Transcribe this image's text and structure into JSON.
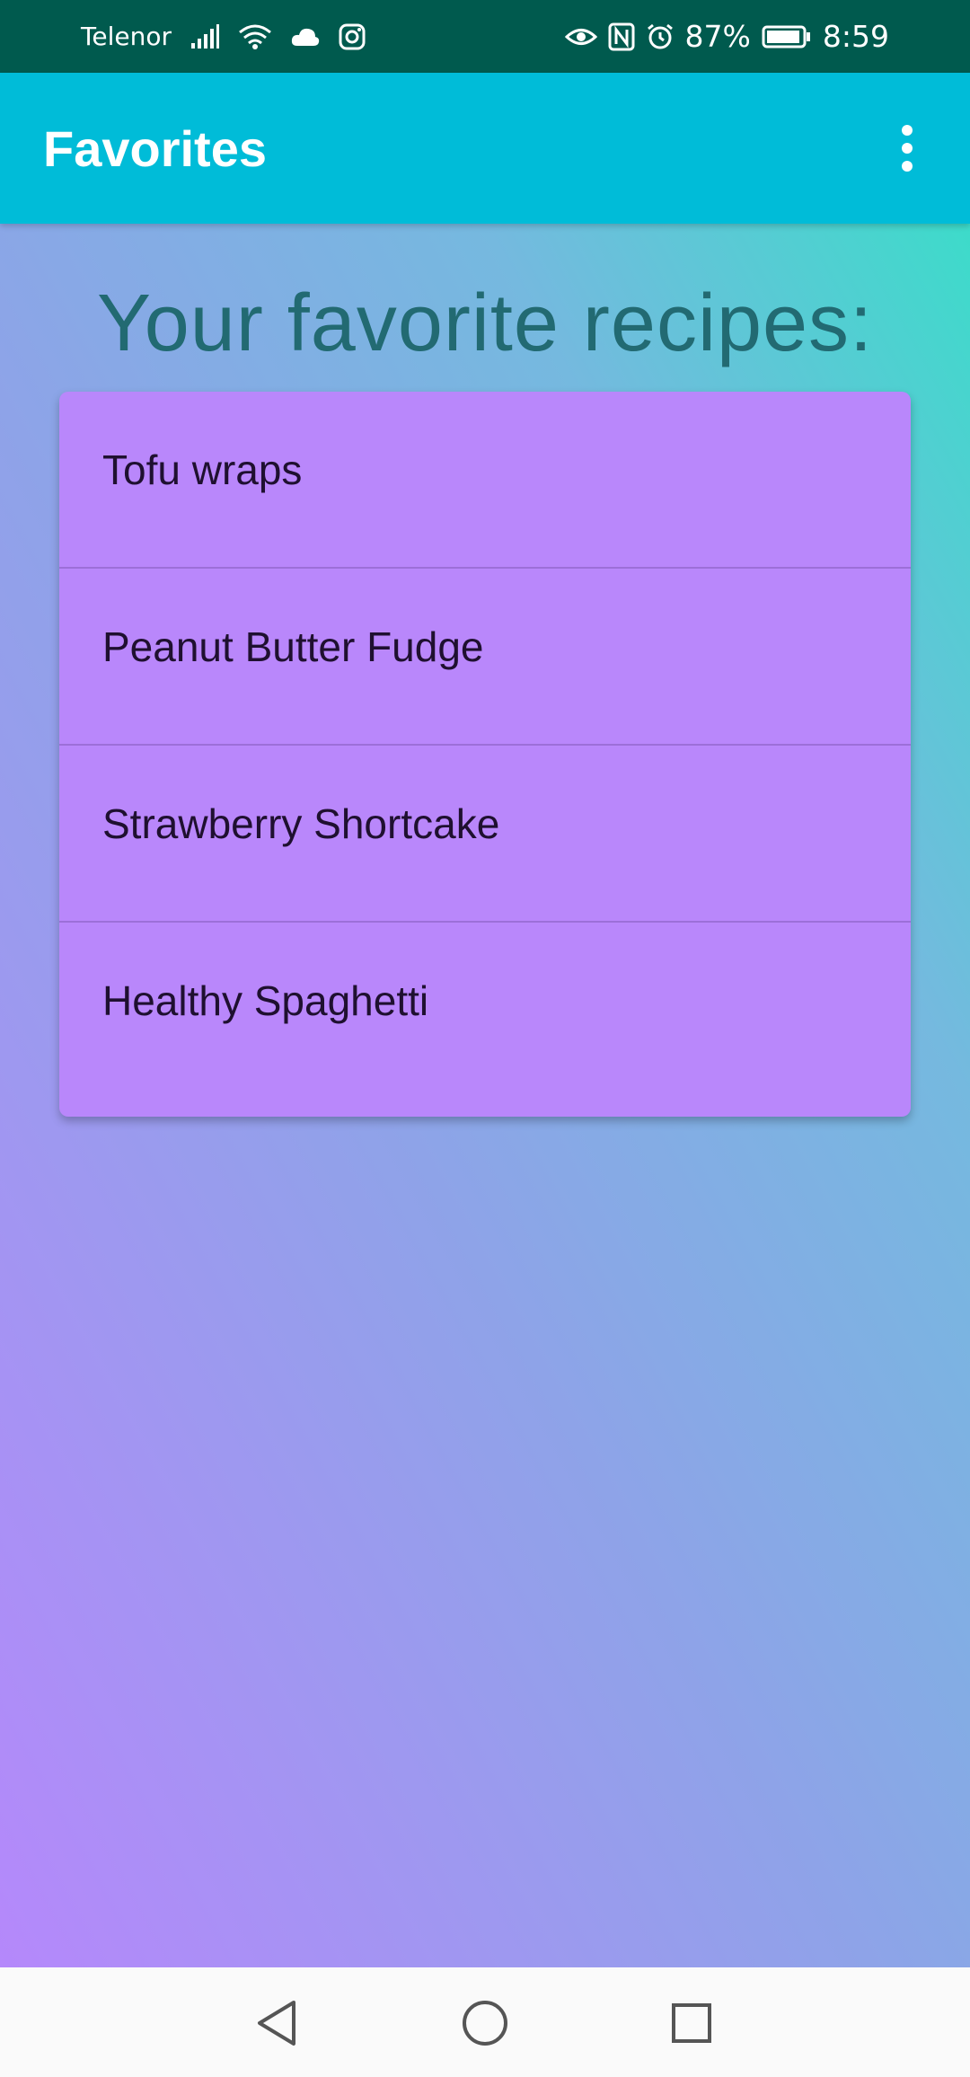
{
  "status_bar": {
    "carrier": "Telenor",
    "battery_percent": "87%",
    "time": "8:59",
    "icons_left": [
      "signal-icon",
      "wifi-icon",
      "cloud-icon",
      "instagram-icon"
    ],
    "icons_right": [
      "eye-icon",
      "nfc-icon",
      "alarm-icon",
      "battery-icon"
    ]
  },
  "app_bar": {
    "title": "Favorites",
    "menu_icon": "overflow-menu-icon",
    "color": "#00bcd8"
  },
  "main": {
    "heading": "Your favorite recipes:",
    "recipes": [
      {
        "label": "Tofu wraps"
      },
      {
        "label": "Peanut Butter Fudge"
      },
      {
        "label": "Strawberry Shortcake"
      },
      {
        "label": "Healthy Spaghetti"
      }
    ],
    "card_color": "#b987fb"
  },
  "nav_bar": {
    "buttons": [
      "back-icon",
      "home-icon",
      "recents-icon"
    ]
  }
}
